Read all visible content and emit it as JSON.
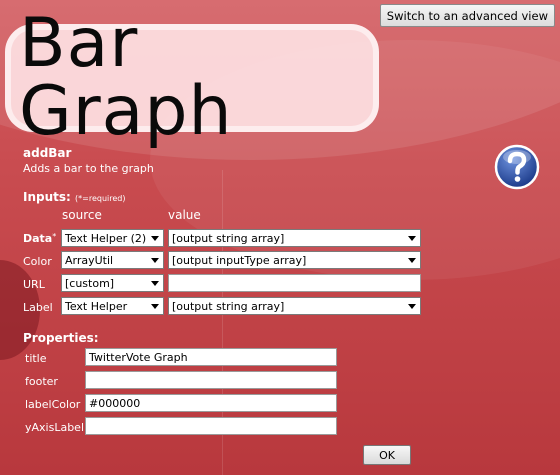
{
  "toolbar": {
    "advanced_label": "Switch to an advanced view"
  },
  "header": {
    "title": "Bar Graph"
  },
  "function": {
    "name": "addBar",
    "description": "Adds a bar to the graph"
  },
  "inputs": {
    "heading": "Inputs:",
    "required_note": "(*=required)",
    "source_header": "source",
    "value_header": "value",
    "rows": [
      {
        "label": "Data",
        "required": "*",
        "source": "Text Helper (2)",
        "value": "[output string array]",
        "value_is_select": true
      },
      {
        "label": "Color",
        "required": "",
        "source": "ArrayUtil",
        "value": "[output inputType array]",
        "value_is_select": true
      },
      {
        "label": "URL",
        "required": "",
        "source": "[custom]",
        "value": "",
        "value_is_select": false
      },
      {
        "label": "Label",
        "required": "",
        "source": "Text Helper",
        "value": "[output string array]",
        "value_is_select": true
      }
    ]
  },
  "properties": {
    "heading": "Properties:",
    "fields": [
      {
        "label": "title",
        "value": "TwitterVote Graph"
      },
      {
        "label": "footer",
        "value": ""
      },
      {
        "label": "labelColor",
        "value": "#000000"
      },
      {
        "label": "yAxisLabel",
        "value": ""
      }
    ]
  },
  "ok_label": "OK",
  "icons": {
    "help": "help-question-icon",
    "dropdown": "chevron-down-icon"
  },
  "colors": {
    "background": "#c84a4e",
    "help_blue": "#2a4d9e"
  }
}
